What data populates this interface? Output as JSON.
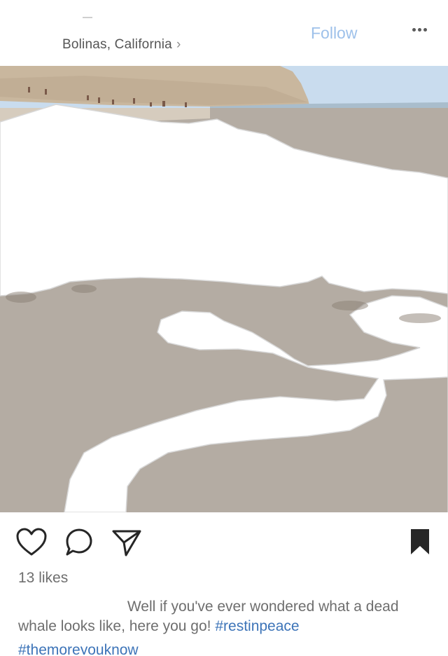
{
  "header": {
    "location": "Bolinas, California",
    "follow_label": "Follow",
    "location_chevron": "›",
    "more_icon": "more-horizontal-icon"
  },
  "post": {
    "likes": "13 likes",
    "caption_text": "Well if you've ever wondered what a dead whale looks like, here you go!",
    "hashtags": [
      "#restinpeace",
      "#themoreyouknow"
    ],
    "icons": {
      "like": "heart-icon",
      "comment": "comment-icon",
      "share": "send-icon",
      "save": "bookmark-icon"
    }
  },
  "colors": {
    "follow": "#9ec1ea",
    "hashtag": "#3d74b8",
    "text_muted": "#6e6e6e",
    "sand": "#b6aea6",
    "sky": "#c8dbee"
  }
}
